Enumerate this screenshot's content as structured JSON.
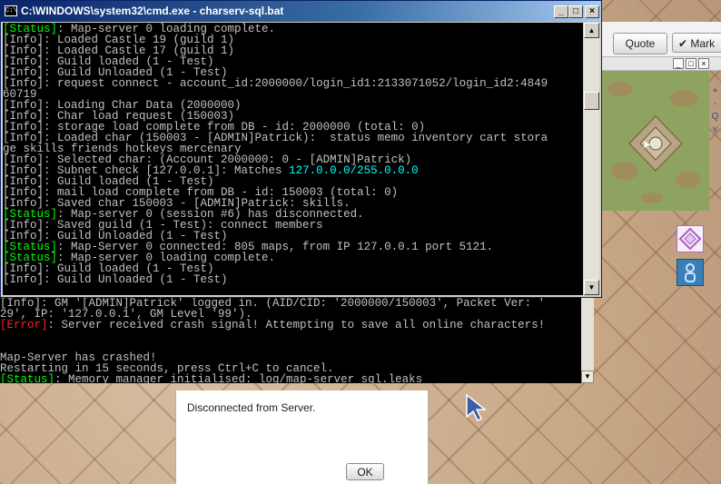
{
  "console_window": {
    "title": "C:\\WINDOWS\\system32\\cmd.exe - charserv-sql.bat",
    "icon_label": "C:\\",
    "lines": [
      [
        {
          "t": "[Status]",
          "c": "status"
        },
        {
          "t": ": Map-server 0 loading complete.",
          "c": "info"
        }
      ],
      [
        {
          "t": "[Info]",
          "c": "info"
        },
        {
          "t": ": Loaded Castle 19 (guild 1)",
          "c": "info"
        }
      ],
      [
        {
          "t": "[Info]",
          "c": "info"
        },
        {
          "t": ": Loaded Castle 17 (guild 1)",
          "c": "info"
        }
      ],
      [
        {
          "t": "[Info]",
          "c": "info"
        },
        {
          "t": ": Guild loaded (1 - Test)",
          "c": "info"
        }
      ],
      [
        {
          "t": "[Info]",
          "c": "info"
        },
        {
          "t": ": Guild Unloaded (1 - Test)",
          "c": "info"
        }
      ],
      [
        {
          "t": "[Info]",
          "c": "info"
        },
        {
          "t": ": request connect - account_id:2000000/login_id1:2133071052/login_id2:4849",
          "c": "info"
        }
      ],
      [
        {
          "t": "60719",
          "c": "info"
        }
      ],
      [
        {
          "t": "[Info]",
          "c": "info"
        },
        {
          "t": ": Loading Char Data (2000000)",
          "c": "info"
        }
      ],
      [
        {
          "t": "[Info]",
          "c": "info"
        },
        {
          "t": ": Char load request (150003)",
          "c": "info"
        }
      ],
      [
        {
          "t": "[Info]",
          "c": "info"
        },
        {
          "t": ": storage load complete from DB - id: 2000000 (total: 0)",
          "c": "info"
        }
      ],
      [
        {
          "t": "[Info]",
          "c": "info"
        },
        {
          "t": ": Loaded char (150003 - [ADMIN]Patrick):  status memo inventory cart stora",
          "c": "info"
        }
      ],
      [
        {
          "t": "ge skills friends hotkeys mercenary",
          "c": "info"
        }
      ],
      [
        {
          "t": "[Info]",
          "c": "info"
        },
        {
          "t": ": Selected char: (Account 2000000: 0 - [ADMIN]Patrick)",
          "c": "info"
        }
      ],
      [
        {
          "t": "[Info]",
          "c": "info"
        },
        {
          "t": ": Subnet check [127.0.0.1]: Matches ",
          "c": "info"
        },
        {
          "t": "127.0.0.0/255.0.0.0",
          "c": "cyan"
        }
      ],
      [
        {
          "t": "[Info]",
          "c": "info"
        },
        {
          "t": ": Guild loaded (1 - Test)",
          "c": "info"
        }
      ],
      [
        {
          "t": "[Info]",
          "c": "info"
        },
        {
          "t": ": mail load complete from DB - id: 150003 (total: 0)",
          "c": "info"
        }
      ],
      [
        {
          "t": "[Info]",
          "c": "info"
        },
        {
          "t": ": Saved char 150003 - [ADMIN]Patrick: skills.",
          "c": "info"
        }
      ],
      [
        {
          "t": "[Status]",
          "c": "status"
        },
        {
          "t": ": Map-server 0 (session #6) has disconnected.",
          "c": "info"
        }
      ],
      [
        {
          "t": "[Info]",
          "c": "info"
        },
        {
          "t": ": Saved guild (1 - Test): connect members",
          "c": "info"
        }
      ],
      [
        {
          "t": "[Info]",
          "c": "info"
        },
        {
          "t": ": Guild Unloaded (1 - Test)",
          "c": "info"
        }
      ],
      [
        {
          "t": "[Status]",
          "c": "status"
        },
        {
          "t": ": Map-Server 0 connected: 805 maps, from IP 127.0.0.1 port 5121.",
          "c": "info"
        }
      ],
      [
        {
          "t": "[Status]",
          "c": "status"
        },
        {
          "t": ": Map-server 0 loading complete.",
          "c": "info"
        }
      ],
      [
        {
          "t": "[Info]",
          "c": "info"
        },
        {
          "t": ": Guild loaded (1 - Test)",
          "c": "info"
        }
      ],
      [
        {
          "t": "[Info]",
          "c": "info"
        },
        {
          "t": ": Guild Unloaded (1 - Test)",
          "c": "info"
        }
      ]
    ]
  },
  "back_console": {
    "lines": [
      [
        {
          "t": "[Info]: GM '[ADMIN]Patrick' logged in. (AID/CID: '2000000/150003', Packet Ver: '",
          "c": "info"
        }
      ],
      [
        {
          "t": "29', IP: '127.0.0.1', GM Level '99').",
          "c": "info"
        }
      ],
      [
        {
          "t": "[Error]",
          "c": "error"
        },
        {
          "t": ": Server received crash signal! Attempting to save all online characters!",
          "c": "info"
        }
      ],
      [
        {
          "t": "",
          "c": "info"
        }
      ],
      [
        {
          "t": "",
          "c": "info"
        }
      ],
      [
        {
          "t": "Map-Server has crashed!",
          "c": "info"
        }
      ],
      [
        {
          "t": "Restarting in 15 seconds, press Ctrl+C to cancel.",
          "c": "info"
        }
      ],
      [
        {
          "t": "[Status]",
          "c": "status"
        },
        {
          "t": ": Memory manager initialised: log/map-server_sql.leaks",
          "c": "info"
        }
      ]
    ]
  },
  "game_ui": {
    "quote_label": "Quote",
    "mark_label": "Mark",
    "minimap_controls": [
      "+",
      "-",
      "Q",
      "v"
    ]
  },
  "dialog": {
    "message": "Disconnected from Server.",
    "ok_label": "OK"
  },
  "colors": {
    "status": "#00ff00",
    "info": "#c0c0c0",
    "error": "#ff2020",
    "cyan": "#00ffff",
    "title_bar": "#0a246a"
  }
}
